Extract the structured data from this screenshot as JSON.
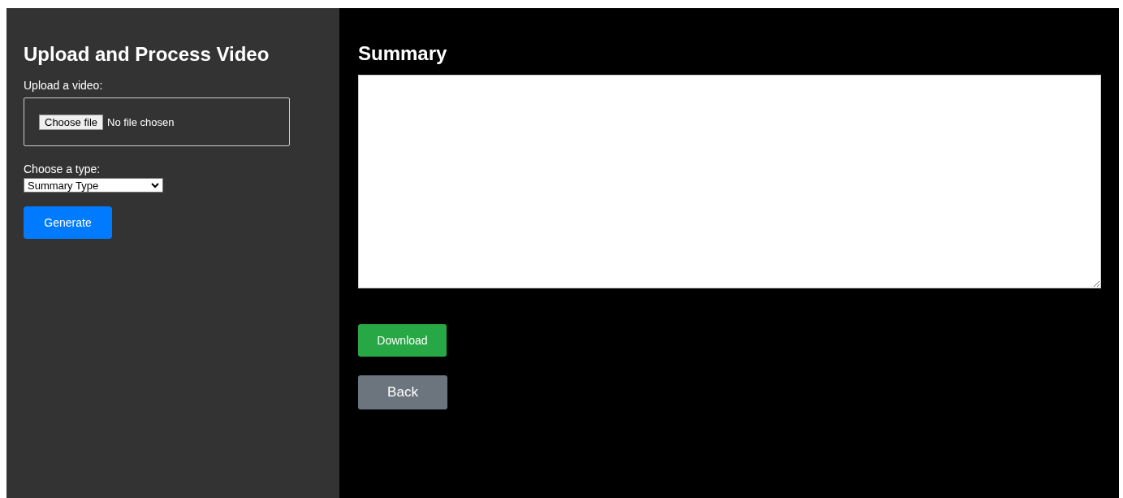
{
  "upload_panel": {
    "title": "Upload and Process Video",
    "file_label": "Upload a video:",
    "file_button": "Choose file",
    "file_status": "No file chosen",
    "type_label": "Choose a type:",
    "type_select": "Summary Type",
    "generate_button": "Generate"
  },
  "summary_panel": {
    "title": "Summary",
    "download_button": "Download",
    "back_button": "Back"
  }
}
